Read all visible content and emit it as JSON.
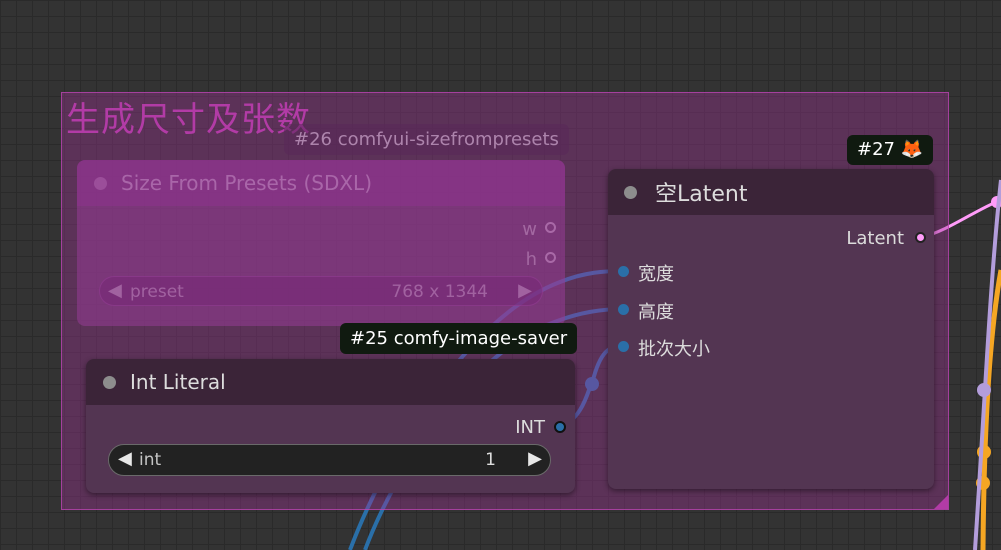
{
  "group": {
    "title": "生成尺寸及张数"
  },
  "badges": {
    "node26": "#26 comfyui-sizefrompresets",
    "node25": "#25 comfy-image-saver",
    "node27": "#27 🦊"
  },
  "size_from_presets": {
    "title": "Size From Presets (SDXL)",
    "outputs": [
      "w",
      "h"
    ],
    "preset_label": "preset",
    "preset_value": "768 x 1344"
  },
  "int_literal": {
    "title": "Int Literal",
    "output": "INT",
    "widget_label": "int",
    "widget_value": "1"
  },
  "empty_latent": {
    "title": "空Latent",
    "output": "Latent",
    "inputs": [
      "宽度",
      "高度",
      "批次大小"
    ]
  },
  "colors": {
    "group": "#a0329680",
    "int_link": "#2a6fa8",
    "latent_link": "#ff9cf9",
    "image_link": "#f5a623",
    "clip_link": "#b39ddb"
  }
}
